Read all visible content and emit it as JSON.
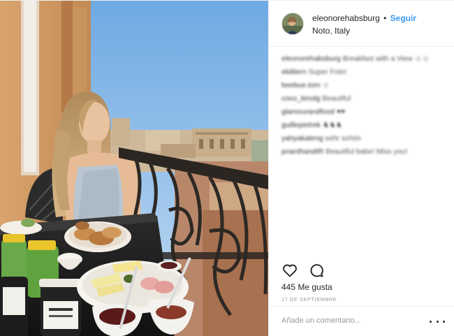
{
  "post": {
    "username": "eleonorehabsburg",
    "separator": "•",
    "follow_label": "Seguir",
    "location": "Noto, Italy",
    "comments": [
      {
        "user": "eleonorehabsburg",
        "text": "Breakfast with a View ☺☺"
      },
      {
        "user": "ekiiliern",
        "text": "Super Foto!"
      },
      {
        "user": "beebue.tom",
        "text": "☺"
      },
      {
        "user": "coco_kinolg",
        "text": "Beautiful"
      },
      {
        "user": "glamourandfood",
        "text": "♥♥"
      },
      {
        "user": "guillepietrek",
        "text": "♞♞♞"
      },
      {
        "user": "yahyakateng",
        "text": "sehr schön"
      },
      {
        "user": "pnanthandIR",
        "text": "Beautiful babe! Miss you!"
      }
    ],
    "like_icon": "heart-outline-icon",
    "comment_icon": "speech-bubble-icon",
    "likes_text": "445 Me gusta",
    "date_text": "17 DE SEPTIEMBRE",
    "comment_placeholder": "Añade un comentario...",
    "more_icon": "ellipsis-icon"
  }
}
